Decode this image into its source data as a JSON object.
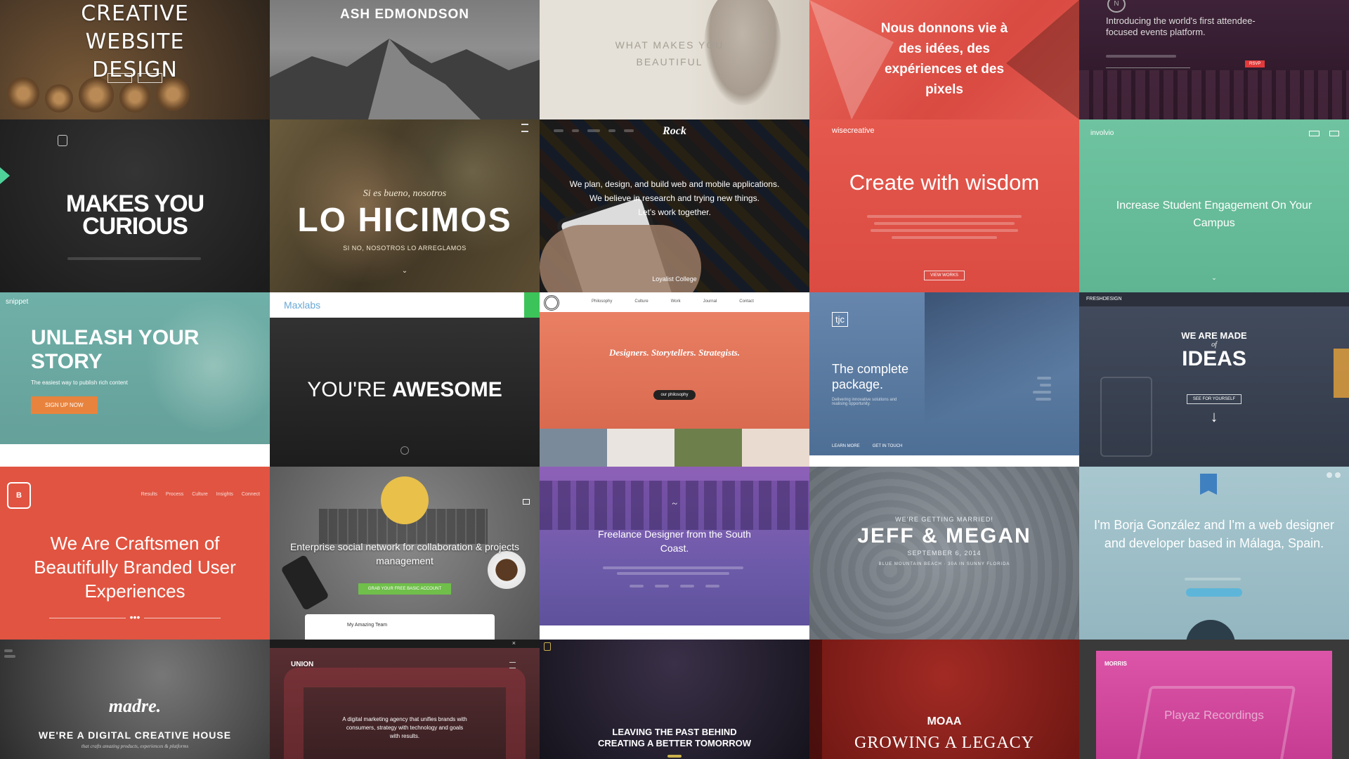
{
  "tiles": [
    {
      "id": "creative-website-design",
      "title": "CREATIVE WEBSITE DESIGN",
      "bg": "#5f4a32"
    },
    {
      "id": "ash-edmondson",
      "title": "ASH EDMONDSON",
      "bg": "#7d7d7d"
    },
    {
      "id": "what-makes-you-beautiful",
      "title": "WHAT MAKES YOU BEAUTIFUL",
      "bg": "#e3ddd3"
    },
    {
      "id": "nous-donnons",
      "title": "Nous donnons vie à des idées, des expériences et des pixels",
      "bg": "#e55a4e"
    },
    {
      "id": "events-platform",
      "title": "Introducing the world's first attendee-focused events platform.",
      "button": "RSVP",
      "bg": "#3b1e34"
    },
    {
      "id": "makes-you-curious",
      "title": "MAKES YOU CURIOUS",
      "bg": "#262626"
    },
    {
      "id": "lo-hicimos",
      "subtitle": "Si es bueno, nosotros",
      "title": "LO HICIMOS",
      "tagline": "SI NO, NOSOTROS LO ARREGLAMOS",
      "bg": "#4a4330"
    },
    {
      "id": "rock",
      "logo": "Rock",
      "line1": "We plan, design, and build web and mobile applications.",
      "line2": "We believe in research and trying new things.",
      "line3": "Let's work together.",
      "caption": "Loyalist College",
      "bg": "#3a3a3a"
    },
    {
      "id": "wisecreative",
      "logo": "wisecreative",
      "title": "Create with wisdom",
      "button": "VIEW WORKS",
      "bg": "#e4584d"
    },
    {
      "id": "involvio",
      "logo": "involvio",
      "title": "Increase Student Engagement On Your Campus",
      "bg": "#6dbf9c"
    },
    {
      "id": "snippet",
      "logo": "snippet",
      "title": "UNLEASH YOUR STORY",
      "subtitle": "The easiest way to publish rich content",
      "button": "SIGN UP NOW",
      "bg": "#6faaa4"
    },
    {
      "id": "maxlabs",
      "logo": "Maxlabs",
      "title_light": "YOU'RE",
      "title_bold": "AWESOME",
      "bg": "#2b2b2b"
    },
    {
      "id": "designers",
      "nav": [
        "Philosophy",
        "Culture",
        "Work",
        "Journal",
        "Contact"
      ],
      "title": "Designers. Storytellers. Strategists.",
      "button": "our philosophy",
      "bg": "#e7765a"
    },
    {
      "id": "tjc",
      "logo": "tjc",
      "title_light": "The complete",
      "title_bold": "package.",
      "subtitle": "Delivering innovative solutions and realising opportunity.",
      "link1": "LEARN MORE",
      "link2": "GET IN TOUCH",
      "bg": "#5377a0"
    },
    {
      "id": "freshdesign",
      "logo": "FRESHDESIGN",
      "line1": "WE ARE MADE",
      "line2": "of",
      "line3": "IDEAS",
      "button": "SEE FOR YOURSELF",
      "bg": "#3d4656"
    },
    {
      "id": "craftsmen",
      "nav": [
        "Results",
        "Process",
        "Culture",
        "Insights",
        "Connect"
      ],
      "title": "We Are Craftsmen of Beautifully Branded User Experiences",
      "bg": "#e0533f"
    },
    {
      "id": "enterprise-social",
      "title": "Enterprise social network for collaboration & projects management",
      "button": "GRAB YOUR FREE BASIC ACCOUNT",
      "caption": "My Amazing Team",
      "bg": "#6a6a6a"
    },
    {
      "id": "freelance",
      "title": "Freelance Designer from the South Coast.",
      "bg": "#8c5cb3"
    },
    {
      "id": "jeff-megan",
      "pre": "WE'RE GETTING MARRIED!",
      "title": "JEFF & MEGAN",
      "date": "SEPTEMBER 6, 2014",
      "place": "BLUE MOUNTAIN BEACH · 30A IN SUNNY FLORIDA",
      "bg": "#7d848a"
    },
    {
      "id": "borja",
      "title": "I'm Borja González and I'm a web designer and developer based in Málaga, Spain.",
      "word1": "designer",
      "word2": "developer",
      "bg": "#9fc0c9"
    },
    {
      "id": "madre",
      "logo": "madre.",
      "title": "WE'RE A DIGITAL CREATIVE HOUSE",
      "subtitle": "that crafts amazing products, experiences & platforms",
      "bg": "#4b4b4b"
    },
    {
      "id": "union",
      "logo": "UNION",
      "title": "A digital marketing agency that unifies brands with consumers, strategy with technology and goals with results.",
      "bg": "#4e2a2d"
    },
    {
      "id": "leaving-the-past",
      "title": "LEAVING THE PAST BEHIND CREATING A BETTER TOMORROW",
      "bg": "#1d1a26"
    },
    {
      "id": "moaa",
      "logo": "MOAA",
      "title": "GROWING A LEGACY",
      "bg": "#8c1f1b"
    },
    {
      "id": "morris",
      "logo": "MORRIS",
      "title": "Playaz Recordings",
      "bg": "#d64aa0"
    }
  ]
}
